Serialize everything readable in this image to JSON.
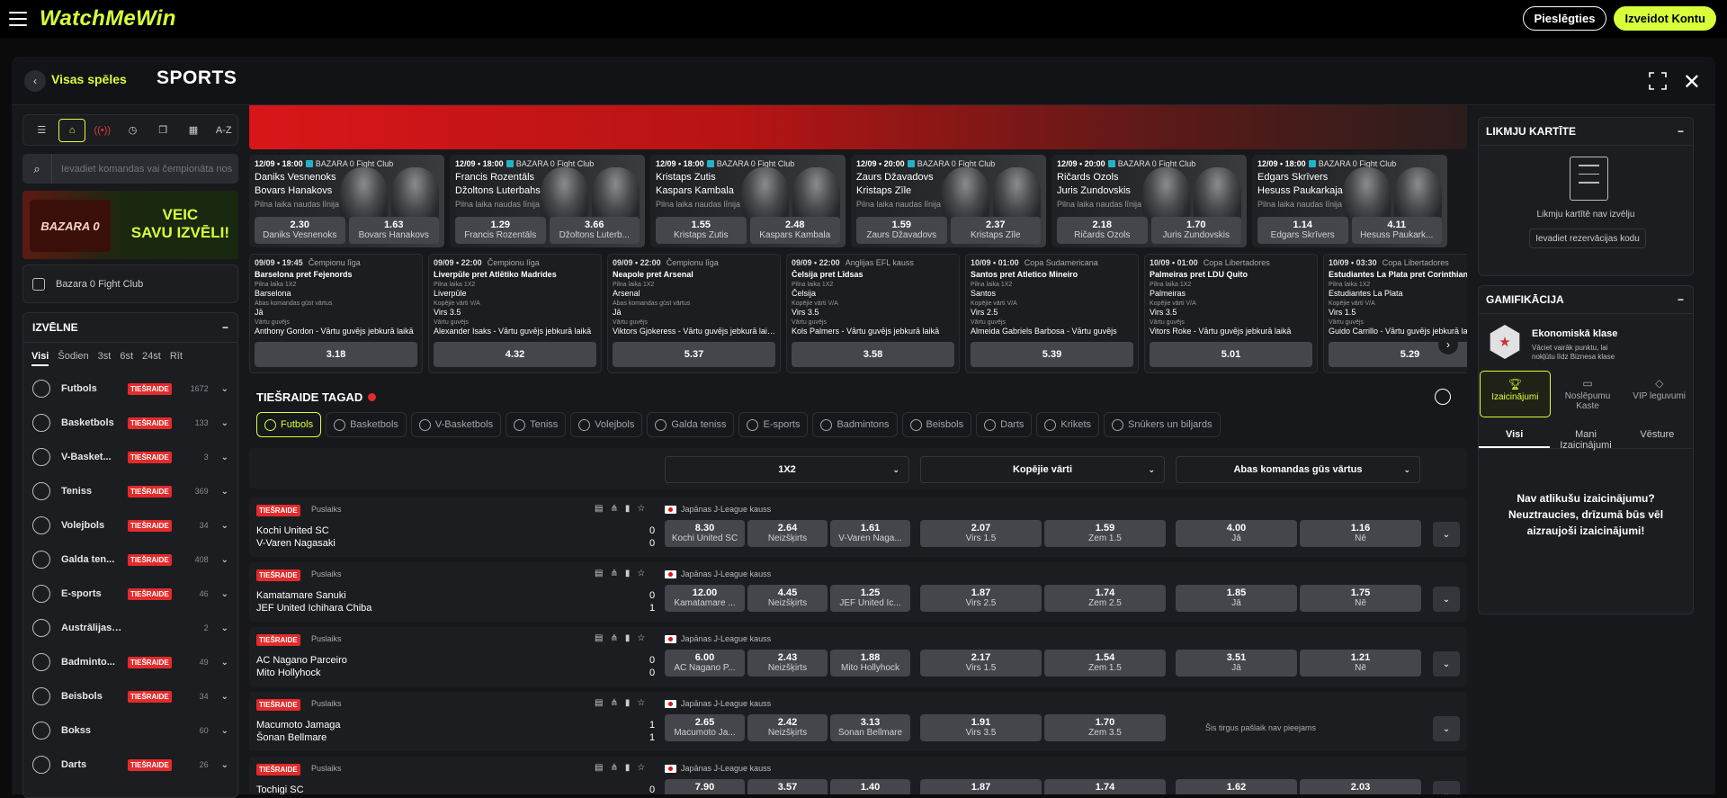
{
  "topbar": {
    "logo": "WatchMeWin",
    "login": "Pieslēgties",
    "register": "Izveidot Kontu"
  },
  "header": {
    "back": "Visas spēles",
    "title": "SPORTS"
  },
  "left": {
    "search_placeholder": "Ievadiet komandas vai čempionāta nos...",
    "promo_logo": "BAZARA 0",
    "promo_text": "VEIC SAVU IZVĒLI!",
    "club": "Bazara 0 Fight Club",
    "menu_title": "IZVĒLNE",
    "days": [
      "Visi",
      "Šodien",
      "3st",
      "6st",
      "24st",
      "Rīt"
    ],
    "sports": [
      {
        "name": "Futbols",
        "live": "TIEŠRAIDE",
        "count": "1672"
      },
      {
        "name": "Basketbols",
        "live": "TIEŠRAIDE",
        "count": "133"
      },
      {
        "name": "V-Basket...",
        "live": "TIEŠRAIDE",
        "count": "3"
      },
      {
        "name": "Teniss",
        "live": "TIEŠRAIDE",
        "count": "369"
      },
      {
        "name": "Volejbols",
        "live": "TIEŠRAIDE",
        "count": "34"
      },
      {
        "name": "Galda ten...",
        "live": "TIEŠRAIDE",
        "count": "408"
      },
      {
        "name": "E-sports",
        "live": "TIEŠRAIDE",
        "count": "46"
      },
      {
        "name": "Austrālijas futbola not...",
        "live": "",
        "count": "2"
      },
      {
        "name": "Badminto...",
        "live": "TIEŠRAIDE",
        "count": "49"
      },
      {
        "name": "Beisbols",
        "live": "TIEŠRAIDE",
        "count": "34"
      },
      {
        "name": "Bokss",
        "live": "",
        "count": "60"
      },
      {
        "name": "Darts",
        "live": "TIEŠRAIDE",
        "count": "26"
      }
    ]
  },
  "fights": [
    {
      "date": "12/09 • 18:00",
      "league": "BAZARA 0 Fight Club",
      "f1": "Daniks Vesnenoks",
      "f2": "Bovars Hanakovs",
      "sub": "Pilna laika naudas līnija",
      "o1": "2.30",
      "o2": "1.63"
    },
    {
      "date": "12/09 • 18:00",
      "league": "BAZARA 0 Fight Club",
      "f1": "Francis Rozentāls",
      "f2": "Džoltons Luterbahs",
      "sub": "Pilna laika naudas līnija",
      "o1": "1.29",
      "o2": "3.66",
      "l2": "Džoltons Luterb..."
    },
    {
      "date": "12/09 • 18:00",
      "league": "BAZARA 0 Fight Club",
      "f1": "Kristaps Zutis",
      "f2": "Kaspars Kambala",
      "sub": "Pilna laika naudas līnija",
      "o1": "1.55",
      "o2": "2.48"
    },
    {
      "date": "12/09 • 20:00",
      "league": "BAZARA 0 Fight Club",
      "f1": "Zaurs Džavadovs",
      "f2": "Kristaps Zīle",
      "sub": "Pilna laika naudas līnija",
      "o1": "1.59",
      "o2": "2.37"
    },
    {
      "date": "12/09 • 20:00",
      "league": "BAZARA 0 Fight Club",
      "f1": "Ričards Ozols",
      "f2": "Juris Zundovskis",
      "sub": "Pilna laika naudas līnija",
      "o1": "2.18",
      "o2": "1.70"
    },
    {
      "date": "12/09 • 18:00",
      "league": "BAZARA 0 Fight Club",
      "f1": "Edgars Skrīvers",
      "f2": "Hesuss Paukarkaja Lopess",
      "sub": "Pilna laika naudas līnija",
      "o1": "1.14",
      "o2": "4.11",
      "l2": "Hesuss Paukark..."
    }
  ],
  "matches": [
    {
      "date": "09/09 • 19:45",
      "league": "Čempionu līga",
      "title": "Barselona pret Fejenords",
      "m1": "Pilna laika 1X2",
      "p1": "Barselona",
      "m2": "Abas komandas gūst vārtus",
      "p2": "Jā",
      "m3": "Vārtu guvējs",
      "p3": "Anthony Gordon - Vārtu guvējs jebkurā laikā",
      "odd": "3.18"
    },
    {
      "date": "09/09 • 22:00",
      "league": "Čempionu līga",
      "title": "Liverpūle pret Atlētiko Madrides",
      "m1": "Pilna laika 1X2",
      "p1": "Liverpūle",
      "m2": "Kopējie vārti V/A",
      "p2": "Virs 3.5",
      "m3": "Vārtu guvējs",
      "p3": "Alexander Isaks - Vārtu guvējs jebkurā laikā",
      "odd": "4.32"
    },
    {
      "date": "09/09 • 22:00",
      "league": "Čempionu līga",
      "title": "Neapole pret Arsenal",
      "m1": "Pilna laika 1X2",
      "p1": "Arsenal",
      "m2": "Abas komandas gūst vārtus",
      "p2": "Jā",
      "m3": "Vārtu guvējs",
      "p3": "Viktors Gjokeress - Vārtu guvējs jebkurā laikā",
      "odd": "5.37"
    },
    {
      "date": "09/09 • 22:00",
      "league": "Anglijas EFL kauss",
      "title": "Čelsija pret Līdsas",
      "m1": "Pilna laika 1X2",
      "p1": "Čelsija",
      "m2": "Kopējie vārti V/A",
      "p2": "Virs 3.5",
      "m3": "Vārtu guvējs",
      "p3": "Kols Palmers - Vārtu guvējs jebkurā laikā",
      "odd": "3.58"
    },
    {
      "date": "10/09 • 01:00",
      "league": "Copa Sudamericana",
      "title": "Santos pret Atletico Mineiro",
      "m1": "Pilna laika 1X2",
      "p1": "Santos",
      "m2": "Kopējie vārti V/A",
      "p2": "Virs 2.5",
      "m3": "Vārtu guvējs",
      "p3": "Almeida Gabriels Barbosa - Vārtu guvējs",
      "odd": "5.39"
    },
    {
      "date": "10/09 • 01:00",
      "league": "Copa Libertadores",
      "title": "Palmeiras pret LDU Quito",
      "m1": "Pilna laika 1X2",
      "p1": "Palmeiras",
      "m2": "Kopējie vārti V/A",
      "p2": "Virs 3.5",
      "m3": "Vārtu guvējs",
      "p3": "Vitors Roke - Vārtu guvējs jebkurā laikā",
      "odd": "5.01"
    },
    {
      "date": "10/09 • 03:30",
      "league": "Copa Libertadores",
      "title": "Estudiantes La Plata pret Corinthians",
      "m1": "Pilna laika 1X2",
      "p1": "Estudiantes La Plata",
      "m2": "Kopējie vārti V/A",
      "p2": "Virs 1.5",
      "m3": "Vārtu guvējs",
      "p3": "Guido Carrillo - Vārtu guvējs jebkurā laikā",
      "odd": "5.29"
    }
  ],
  "live": {
    "title": "TIEŠRAIDE TAGAD",
    "tabs": [
      "Futbols",
      "Basketbols",
      "V-Basketbols",
      "Teniss",
      "Volejbols",
      "Galda teniss",
      "E-sports",
      "Badmintons",
      "Beisbols",
      "Darts",
      "Krikets",
      "Snūkers un biljards"
    ],
    "markets": [
      "1X2",
      "Kopējie vārti",
      "Abas komandas gūs vārtus"
    ]
  },
  "events": [
    {
      "live": "TIEŠRAIDE",
      "half": "Puslaiks",
      "league": "Japānas J-League kauss",
      "t1": "Kochi United SC",
      "t2": "V-Varen Nagasaki",
      "s1": "0",
      "s2": "0",
      "odds": [
        [
          "8.30",
          "Kochi United SC"
        ],
        [
          "2.64",
          "Neizšķirts"
        ],
        [
          "1.61",
          "V-Varen Naga..."
        ],
        [
          "2.07",
          "Virs 1.5"
        ],
        [
          "1.59",
          "Zem 1.5"
        ],
        [
          "4.00",
          "Jā"
        ],
        [
          "1.16",
          "Nē"
        ]
      ]
    },
    {
      "live": "TIEŠRAIDE",
      "half": "Puslaiks",
      "league": "Japānas J-League kauss",
      "t1": "Kamatamare Sanuki",
      "t2": "JEF United Ichihara Chiba",
      "s1": "0",
      "s2": "1",
      "odds": [
        [
          "12.00",
          "Kamatamare ..."
        ],
        [
          "4.45",
          "Neizšķirts"
        ],
        [
          "1.25",
          "JEF United Ic..."
        ],
        [
          "1.87",
          "Virs 2.5"
        ],
        [
          "1.74",
          "Zem 2.5"
        ],
        [
          "1.85",
          "Jā"
        ],
        [
          "1.75",
          "Nē"
        ]
      ]
    },
    {
      "live": "TIEŠRAIDE",
      "half": "Puslaiks",
      "league": "Japānas J-League kauss",
      "t1": "AC Nagano Parceiro",
      "t2": "Mito Hollyhock",
      "s1": "0",
      "s2": "0",
      "odds": [
        [
          "6.00",
          "AC Nagano P..."
        ],
        [
          "2.43",
          "Neizšķirts"
        ],
        [
          "1.88",
          "Mito Hollyhock"
        ],
        [
          "2.17",
          "Virs 1.5"
        ],
        [
          "1.54",
          "Zem 1.5"
        ],
        [
          "3.51",
          "Jā"
        ],
        [
          "1.21",
          "Nē"
        ]
      ]
    },
    {
      "live": "TIEŠRAIDE",
      "half": "Puslaiks",
      "league": "Japānas J-League kauss",
      "t1": "Macumoto Jamaga",
      "t2": "Šonan Bellmare",
      "s1": "1",
      "s2": "1",
      "odds": [
        [
          "2.65",
          "Macumoto Ja..."
        ],
        [
          "2.42",
          "Neizšķirts"
        ],
        [
          "3.13",
          "Šonan Bellmare"
        ],
        [
          "1.91",
          "Virs 3.5"
        ],
        [
          "1.70",
          "Zem 3.5"
        ]
      ],
      "na": "Šis tirgus pašlaik nav pieejams"
    },
    {
      "live": "TIEŠRAIDE",
      "half": "Puslaiks",
      "league": "Japānas J-League kauss",
      "t1": "Tochigi SC",
      "t2": "",
      "s1": "0",
      "s2": "",
      "odds": [
        [
          "7.90",
          ""
        ],
        [
          "3.57",
          ""
        ],
        [
          "1.40",
          ""
        ],
        [
          "1.87",
          ""
        ],
        [
          "1.74",
          ""
        ],
        [
          "1.62",
          ""
        ],
        [
          "2.03",
          ""
        ]
      ]
    }
  ],
  "right": {
    "betslip_title": "LIKMJU KARTĪTE",
    "betslip_empty": "Likmju kartītē nav izvēlju",
    "code_btn": "Ievadiet rezervācijas kodu",
    "gam_title": "GAMIFIKĀCIJA",
    "class_title": "Ekonomiskā klase",
    "class_sub": "Vāciet vairāk punktu, lai nokļūtu līdz Biznesa klase",
    "gtabs": [
      "Izaicinājumi",
      "Noslēpumu Kaste",
      "VIP leguvumi"
    ],
    "subtabs": [
      "Visi",
      "Mani Izaicinājumi",
      "Vēsture"
    ],
    "empty": "Nav atlikušu izaicinājumu? Neuztraucies, drīzumā būs vēl aizraujoši izaicinājumi!"
  }
}
